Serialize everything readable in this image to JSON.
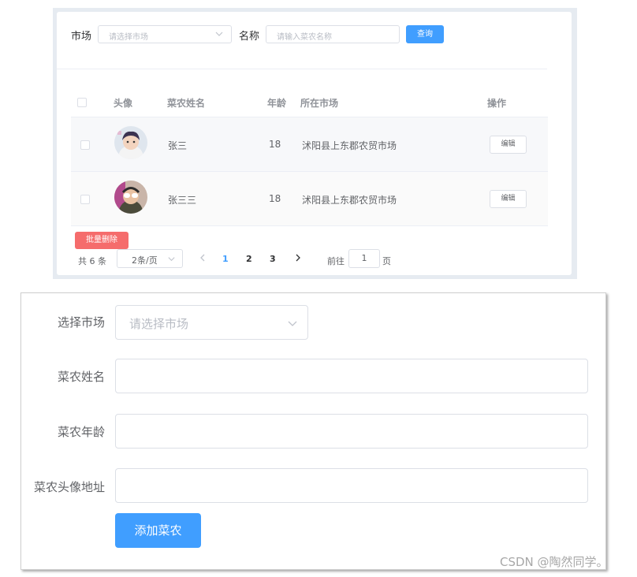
{
  "search": {
    "market_label": "市场",
    "market_placeholder": "请选择市场",
    "name_label": "名称",
    "name_placeholder": "请输入菜农名称",
    "query_button": "查询"
  },
  "table": {
    "headers": [
      "头像",
      "菜农姓名",
      "年龄",
      "所在市场",
      "操作"
    ],
    "rows": [
      {
        "name": "张三",
        "age": "18",
        "market": "沭阳县上东郡农贸市场",
        "action": "编辑"
      },
      {
        "name": "张三三",
        "age": "18",
        "market": "沭阳县上东郡农贸市场",
        "action": "编辑"
      }
    ],
    "batch_delete": "批量删除"
  },
  "pagination": {
    "total": "共 6 条",
    "page_size": "2条/页",
    "pages": [
      "1",
      "2",
      "3"
    ],
    "current_page": "1",
    "goto_label": "前往",
    "goto_value": "1",
    "page_suffix": "页"
  },
  "form": {
    "market_label": "选择市场",
    "market_placeholder": "请选择市场",
    "name_label": "菜农姓名",
    "age_label": "菜农年龄",
    "avatar_label": "菜农头像地址",
    "submit_button": "添加菜农"
  },
  "watermark": "CSDN @陶然同学。",
  "colors": {
    "primary": "#409eff",
    "danger": "#f56c6c"
  },
  "icons": {
    "select_arrow": "chevron-down-icon",
    "prev": "chevron-left-icon",
    "next": "chevron-right-icon"
  }
}
